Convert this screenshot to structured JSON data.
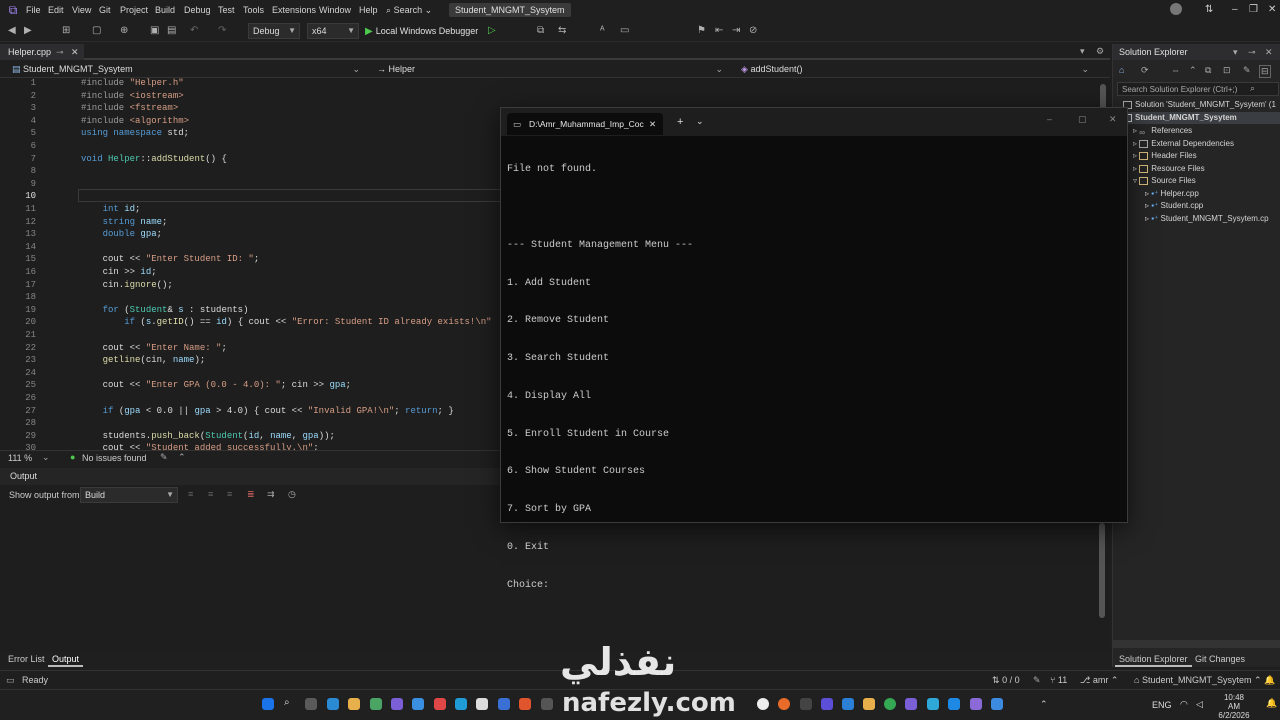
{
  "menu": {
    "items": [
      "File",
      "Edit",
      "View",
      "Git",
      "Project",
      "Build",
      "Debug",
      "Test",
      "Tools",
      "Extensions",
      "Window",
      "Help"
    ],
    "search_label": "Search",
    "solution_name": "Student_MNGMT_Sysytem"
  },
  "toolbar": {
    "config": "Debug",
    "platform": "x64",
    "run_label": "Local Windows Debugger"
  },
  "tabs": {
    "active": "Helper.cpp"
  },
  "navbar": {
    "project": "Student_MNGMT_Sysytem",
    "scope": "Helper",
    "member": "addStudent()"
  },
  "editor": {
    "line_numbers": [
      "1",
      "2",
      "3",
      "4",
      "5",
      "6",
      "7",
      "8",
      "9",
      "10",
      "11",
      "12",
      "13",
      "14",
      "15",
      "16",
      "17",
      "18",
      "19",
      "20",
      "21",
      "22",
      "23",
      "24",
      "25",
      "26",
      "27",
      "28",
      "29",
      "30"
    ],
    "zoom": "111 %",
    "issues": "No issues found"
  },
  "output": {
    "title": "Output",
    "show_from_label": "Show output from:",
    "source": "Build"
  },
  "bottom_tabs": [
    "Error List",
    "Output"
  ],
  "console": {
    "title": "D:\\Amr_Muhammad_Imp_Coc",
    "lines": [
      "File not found.",
      "",
      "--- Student Management Menu ---",
      "1. Add Student",
      "2. Remove Student",
      "3. Search Student",
      "4. Display All",
      "5. Enroll Student in Course",
      "6. Show Student Courses",
      "7. Sort by GPA",
      "0. Exit",
      "Choice:"
    ]
  },
  "solution_explorer": {
    "title": "Solution Explorer",
    "search_placeholder": "Search Solution Explorer (Ctrl+;)",
    "solution": "Solution 'Student_MNGMT_Sysytem' (1",
    "project": "Student_MNGMT_Sysytem",
    "nodes": [
      "References",
      "External Dependencies",
      "Header Files",
      "Resource Files",
      "Source Files"
    ],
    "files": [
      "Helper.cpp",
      "Student.cpp",
      "Student_MNGMT_Sysytem.cp"
    ],
    "bottom_tabs": [
      "Solution Explorer",
      "Git Changes"
    ]
  },
  "status": {
    "ready": "Ready",
    "errors": "0 / 0",
    "changes": "11",
    "user": "amr",
    "project": "Student_MNGMT_Sysytem"
  },
  "taskbar": {
    "lang": "ENG",
    "time": "10:48 AM",
    "date": "6/2/2026"
  },
  "watermark": {
    "arabic": "نفذلي",
    "latin": "nafezly.com"
  }
}
